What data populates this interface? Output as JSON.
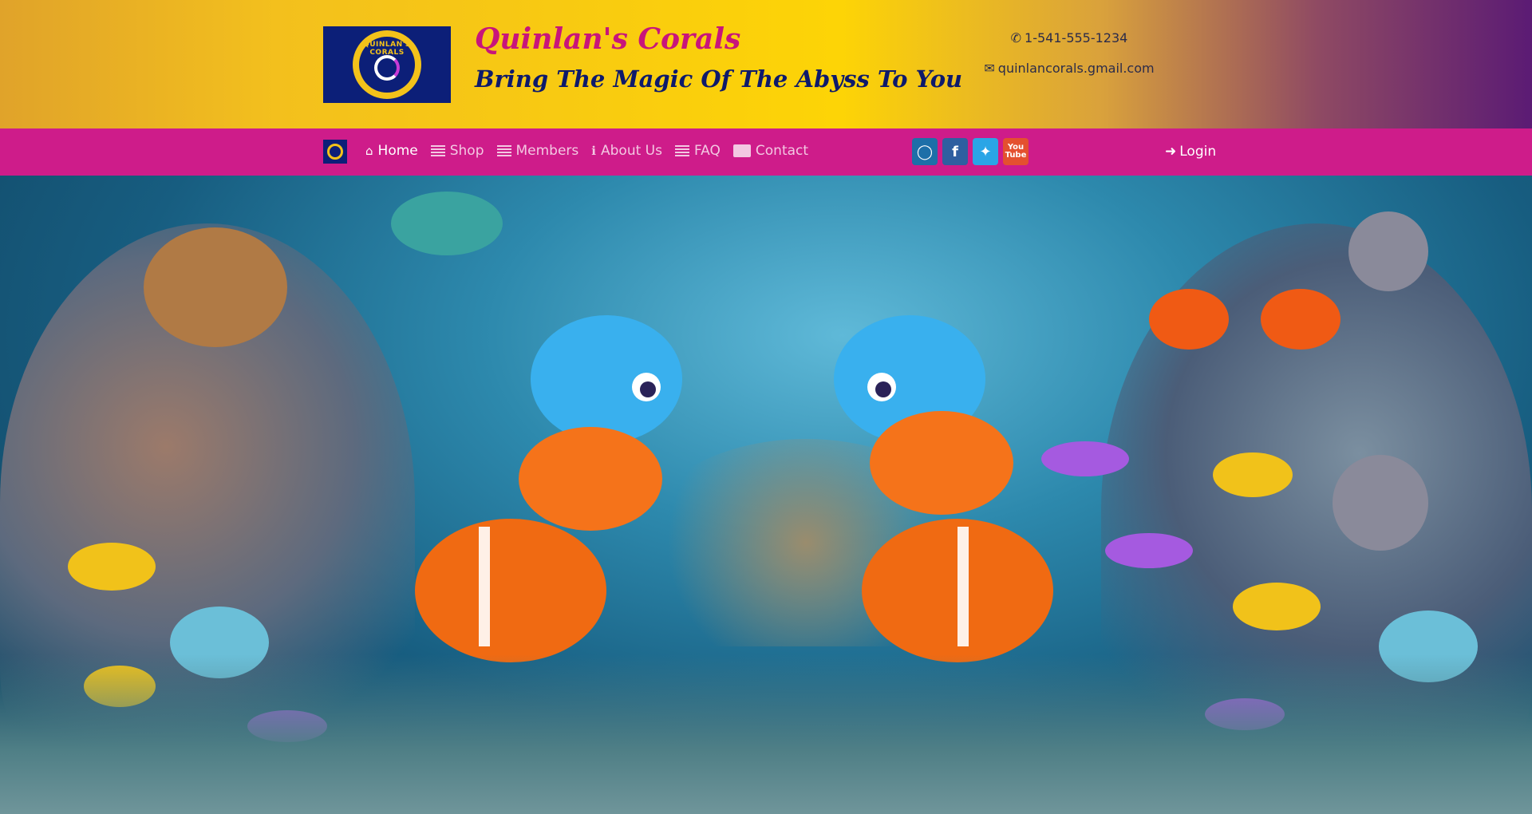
{
  "brand": {
    "logo_text": "QUINLAN'S CORALS",
    "title": "Quinlan's Corals",
    "tagline": "Bring The Magic Of The Abyss To You"
  },
  "contact": {
    "phone": "1-541-555-1234",
    "email": "quinlancorals.gmail.com"
  },
  "nav": {
    "items": [
      {
        "label": "Home",
        "icon": "home-icon",
        "active": true
      },
      {
        "label": "Shop",
        "icon": "list-icon"
      },
      {
        "label": "Members",
        "icon": "list-icon"
      },
      {
        "label": "About Us",
        "icon": "info-icon"
      },
      {
        "label": "FAQ",
        "icon": "list-icon"
      },
      {
        "label": "Contact",
        "icon": "contact-card-icon"
      }
    ],
    "login": "Login"
  },
  "social": [
    {
      "name": "instagram",
      "icon": "instagram-icon"
    },
    {
      "name": "facebook",
      "icon": "facebook-icon"
    },
    {
      "name": "twitter",
      "icon": "twitter-icon"
    },
    {
      "name": "youtube",
      "icon": "youtube-icon",
      "glyph_top": "You",
      "glyph_bottom": "Tube"
    }
  ],
  "colors": {
    "nav_bg": "#ce1c8a",
    "title": "#c8157b",
    "tagline": "#0e1a6b",
    "logo_bg": "#0c1f78"
  }
}
